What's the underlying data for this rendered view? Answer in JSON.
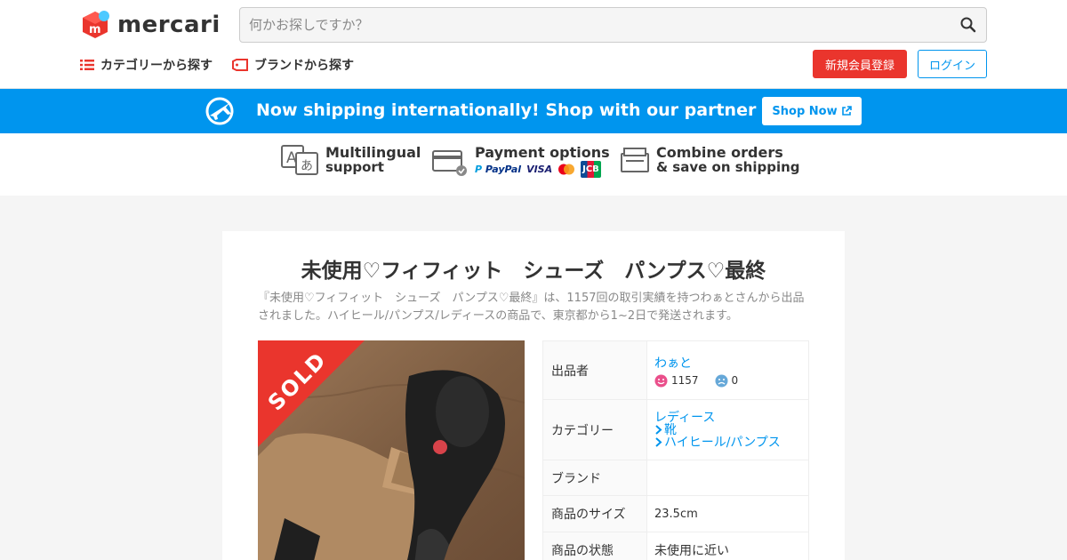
{
  "header": {
    "logo_text": "mercari",
    "search_placeholder": "何かお探しですか？",
    "category_link": "カテゴリーから探す",
    "brand_link": "ブランドから探す",
    "signup_button": "新規会員登録",
    "login_button": "ログイン"
  },
  "banner": {
    "text": "Now shipping internationally! Shop with our partner Buyee!",
    "button": "Shop Now"
  },
  "features": {
    "multilingual_title": "Multilingual",
    "multilingual_sub": "support",
    "payment_title": "Payment options",
    "payment_paypal": "PayPal",
    "payment_visa": "VISA",
    "payment_jcb": "JCB",
    "combine_title": "Combine orders",
    "combine_sub": "& save on shipping"
  },
  "item": {
    "title": "未使用♡フィフィット　シューズ　パンプス♡最終",
    "description": "『未使用♡フィフィット　シューズ　パンプス♡最終』は、1157回の取引実績を持つわぁとさんから出品されました。ハイヒール/パンプス/レディースの商品で、東京都から1~2日で発送されます。",
    "sold_label": "SOLD"
  },
  "details": {
    "seller_label": "出品者",
    "seller_name": "わぁと",
    "rating_good": "1157",
    "rating_bad": "0",
    "category_label": "カテゴリー",
    "category_1": "レディース",
    "category_2": "靴",
    "category_3": "ハイヒール/パンプス",
    "brand_label": "ブランド",
    "brand_value": "",
    "size_label": "商品のサイズ",
    "size_value": "23.5cm",
    "condition_label": "商品の状態",
    "condition_value": "未使用に近い"
  },
  "colors": {
    "brand_red": "#ea352d",
    "accent_blue": "#0095ee"
  }
}
